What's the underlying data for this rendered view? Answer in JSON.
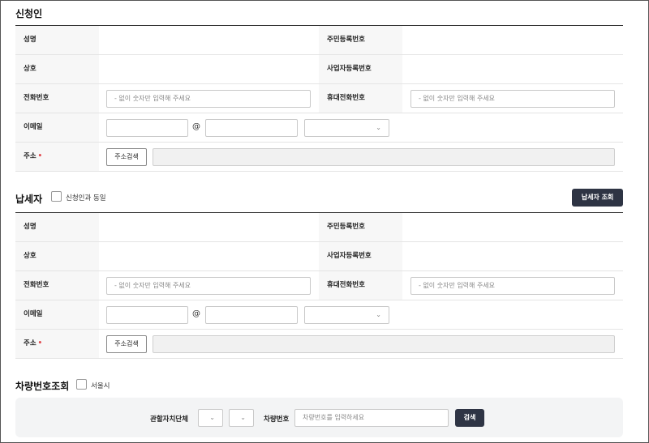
{
  "applicant": {
    "title": "신청인",
    "name_label": "성명",
    "rrn_label": "주민등록번호",
    "company_label": "상호",
    "brn_label": "사업자등록번호",
    "phone_label": "전화번호",
    "phone_placeholder": "- 없이 숫자만 입력해 주세요",
    "mobile_label": "휴대전화번호",
    "mobile_placeholder": "- 없이 숫자만 입력해 주세요",
    "email_label": "이메일",
    "email_at": "@",
    "address_label": "주소",
    "required_mark": "•",
    "address_search_button": "주소검색"
  },
  "taxpayer": {
    "title": "납세자",
    "same_as_applicant_label": "신청인과 동일",
    "lookup_button": "납세자 조회",
    "name_label": "성명",
    "rrn_label": "주민등록번호",
    "company_label": "상호",
    "brn_label": "사업자등록번호",
    "phone_label": "전화번호",
    "phone_placeholder": "- 없이 숫자만 입력해 주세요",
    "mobile_label": "휴대전화번호",
    "mobile_placeholder": "- 없이 숫자만 입력해 주세요",
    "email_label": "이메일",
    "email_at": "@",
    "address_label": "주소",
    "required_mark": "•",
    "address_search_button": "주소검색"
  },
  "vehicle": {
    "title": "차량번호조회",
    "seoul_label": "서울시",
    "jurisdiction_label": "관할자치단체",
    "plate_label": "차량번호",
    "plate_placeholder": "차량번호를 입력하세요",
    "search_button": "검색"
  },
  "icons": {
    "dropdown": "chevron-down-icon"
  },
  "colors": {
    "required": "#e0454a",
    "dark_button": "#2e3444"
  }
}
